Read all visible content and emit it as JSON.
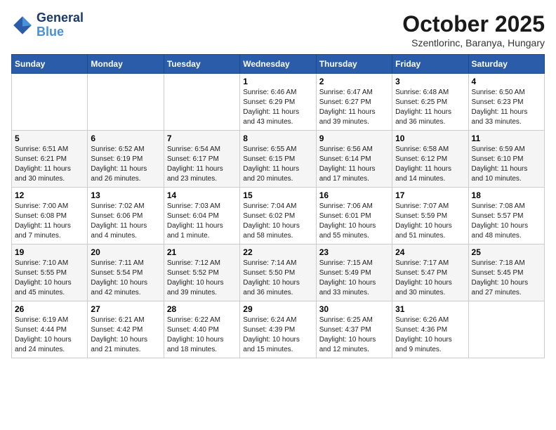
{
  "header": {
    "logo_line1": "General",
    "logo_line2": "Blue",
    "month": "October 2025",
    "location": "Szentlorinc, Baranya, Hungary"
  },
  "weekdays": [
    "Sunday",
    "Monday",
    "Tuesday",
    "Wednesday",
    "Thursday",
    "Friday",
    "Saturday"
  ],
  "weeks": [
    [
      {
        "day": "",
        "info": ""
      },
      {
        "day": "",
        "info": ""
      },
      {
        "day": "",
        "info": ""
      },
      {
        "day": "1",
        "info": "Sunrise: 6:46 AM\nSunset: 6:29 PM\nDaylight: 11 hours\nand 43 minutes."
      },
      {
        "day": "2",
        "info": "Sunrise: 6:47 AM\nSunset: 6:27 PM\nDaylight: 11 hours\nand 39 minutes."
      },
      {
        "day": "3",
        "info": "Sunrise: 6:48 AM\nSunset: 6:25 PM\nDaylight: 11 hours\nand 36 minutes."
      },
      {
        "day": "4",
        "info": "Sunrise: 6:50 AM\nSunset: 6:23 PM\nDaylight: 11 hours\nand 33 minutes."
      }
    ],
    [
      {
        "day": "5",
        "info": "Sunrise: 6:51 AM\nSunset: 6:21 PM\nDaylight: 11 hours\nand 30 minutes."
      },
      {
        "day": "6",
        "info": "Sunrise: 6:52 AM\nSunset: 6:19 PM\nDaylight: 11 hours\nand 26 minutes."
      },
      {
        "day": "7",
        "info": "Sunrise: 6:54 AM\nSunset: 6:17 PM\nDaylight: 11 hours\nand 23 minutes."
      },
      {
        "day": "8",
        "info": "Sunrise: 6:55 AM\nSunset: 6:15 PM\nDaylight: 11 hours\nand 20 minutes."
      },
      {
        "day": "9",
        "info": "Sunrise: 6:56 AM\nSunset: 6:14 PM\nDaylight: 11 hours\nand 17 minutes."
      },
      {
        "day": "10",
        "info": "Sunrise: 6:58 AM\nSunset: 6:12 PM\nDaylight: 11 hours\nand 14 minutes."
      },
      {
        "day": "11",
        "info": "Sunrise: 6:59 AM\nSunset: 6:10 PM\nDaylight: 11 hours\nand 10 minutes."
      }
    ],
    [
      {
        "day": "12",
        "info": "Sunrise: 7:00 AM\nSunset: 6:08 PM\nDaylight: 11 hours\nand 7 minutes."
      },
      {
        "day": "13",
        "info": "Sunrise: 7:02 AM\nSunset: 6:06 PM\nDaylight: 11 hours\nand 4 minutes."
      },
      {
        "day": "14",
        "info": "Sunrise: 7:03 AM\nSunset: 6:04 PM\nDaylight: 11 hours\nand 1 minute."
      },
      {
        "day": "15",
        "info": "Sunrise: 7:04 AM\nSunset: 6:02 PM\nDaylight: 10 hours\nand 58 minutes."
      },
      {
        "day": "16",
        "info": "Sunrise: 7:06 AM\nSunset: 6:01 PM\nDaylight: 10 hours\nand 55 minutes."
      },
      {
        "day": "17",
        "info": "Sunrise: 7:07 AM\nSunset: 5:59 PM\nDaylight: 10 hours\nand 51 minutes."
      },
      {
        "day": "18",
        "info": "Sunrise: 7:08 AM\nSunset: 5:57 PM\nDaylight: 10 hours\nand 48 minutes."
      }
    ],
    [
      {
        "day": "19",
        "info": "Sunrise: 7:10 AM\nSunset: 5:55 PM\nDaylight: 10 hours\nand 45 minutes."
      },
      {
        "day": "20",
        "info": "Sunrise: 7:11 AM\nSunset: 5:54 PM\nDaylight: 10 hours\nand 42 minutes."
      },
      {
        "day": "21",
        "info": "Sunrise: 7:12 AM\nSunset: 5:52 PM\nDaylight: 10 hours\nand 39 minutes."
      },
      {
        "day": "22",
        "info": "Sunrise: 7:14 AM\nSunset: 5:50 PM\nDaylight: 10 hours\nand 36 minutes."
      },
      {
        "day": "23",
        "info": "Sunrise: 7:15 AM\nSunset: 5:49 PM\nDaylight: 10 hours\nand 33 minutes."
      },
      {
        "day": "24",
        "info": "Sunrise: 7:17 AM\nSunset: 5:47 PM\nDaylight: 10 hours\nand 30 minutes."
      },
      {
        "day": "25",
        "info": "Sunrise: 7:18 AM\nSunset: 5:45 PM\nDaylight: 10 hours\nand 27 minutes."
      }
    ],
    [
      {
        "day": "26",
        "info": "Sunrise: 6:19 AM\nSunset: 4:44 PM\nDaylight: 10 hours\nand 24 minutes."
      },
      {
        "day": "27",
        "info": "Sunrise: 6:21 AM\nSunset: 4:42 PM\nDaylight: 10 hours\nand 21 minutes."
      },
      {
        "day": "28",
        "info": "Sunrise: 6:22 AM\nSunset: 4:40 PM\nDaylight: 10 hours\nand 18 minutes."
      },
      {
        "day": "29",
        "info": "Sunrise: 6:24 AM\nSunset: 4:39 PM\nDaylight: 10 hours\nand 15 minutes."
      },
      {
        "day": "30",
        "info": "Sunrise: 6:25 AM\nSunset: 4:37 PM\nDaylight: 10 hours\nand 12 minutes."
      },
      {
        "day": "31",
        "info": "Sunrise: 6:26 AM\nSunset: 4:36 PM\nDaylight: 10 hours\nand 9 minutes."
      },
      {
        "day": "",
        "info": ""
      }
    ]
  ]
}
